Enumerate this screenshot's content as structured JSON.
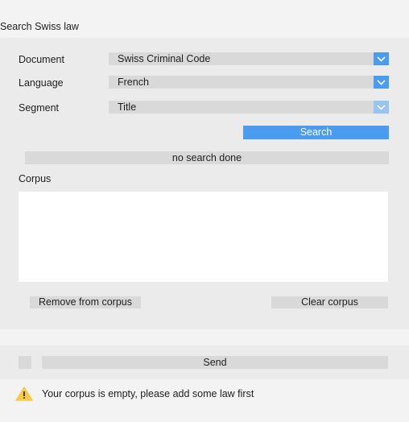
{
  "app": {
    "title": "Search Swiss law"
  },
  "form": {
    "document": {
      "label": "Document",
      "value": "Swiss Criminal Code"
    },
    "language": {
      "label": "Language",
      "value": "French"
    },
    "segment": {
      "label": "Segment",
      "value": "Title"
    },
    "search_button": "Search",
    "status": "no search done"
  },
  "corpus": {
    "label": "Corpus",
    "items": [],
    "remove_button": "Remove from corpus",
    "clear_button": "Clear corpus"
  },
  "send": {
    "button": "Send",
    "checked": false
  },
  "notice": {
    "icon": "warning-icon",
    "text": "Your corpus is empty, please add some law first",
    "icon_color": "#f7c948"
  },
  "colors": {
    "accent": "#4a9cf0",
    "accent_disabled": "#97c4f4"
  }
}
